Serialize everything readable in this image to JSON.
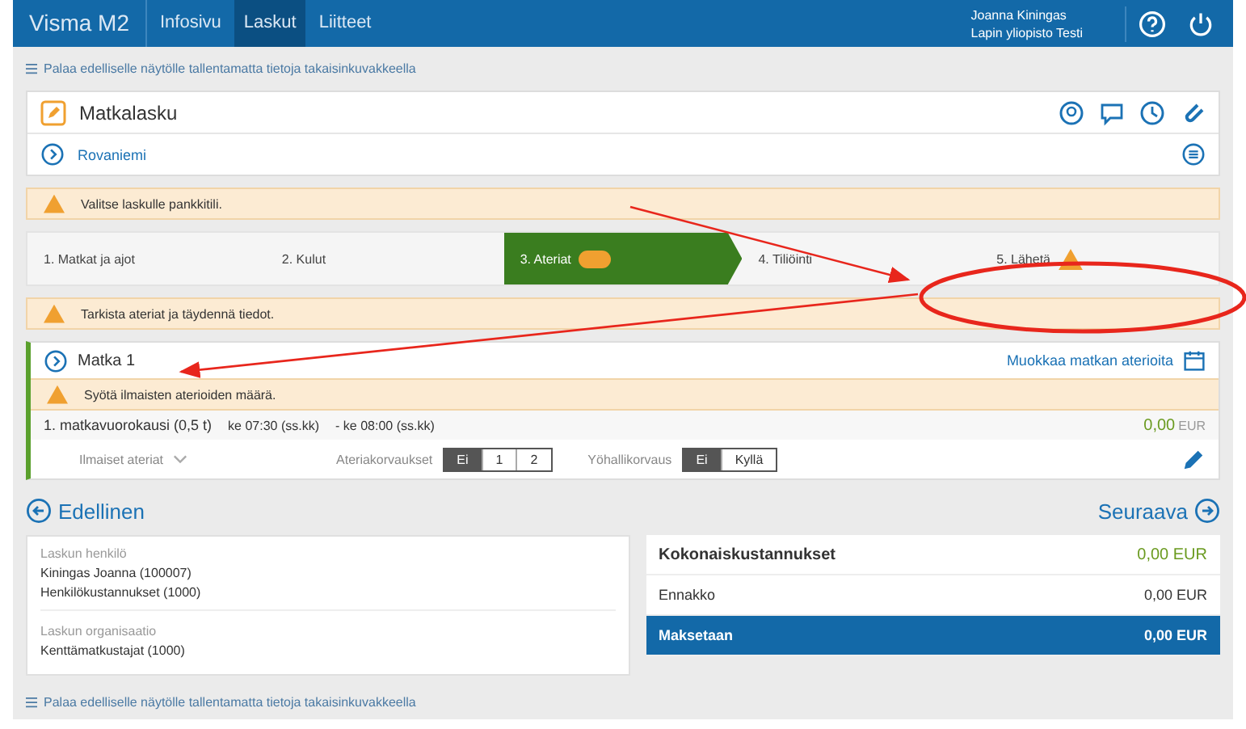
{
  "topbar": {
    "brand": "Visma M2",
    "nav": [
      {
        "label": "Infosivu",
        "selected": false
      },
      {
        "label": "Laskut",
        "selected": true
      },
      {
        "label": "Liitteet",
        "selected": false
      }
    ],
    "user": {
      "name": "Joanna Kiningas",
      "org": "Lapin yliopisto Testi"
    }
  },
  "back_link_top": "Palaa edelliselle näytölle tallentamatta tietoja takaisinkuvakkeella",
  "header": {
    "title": "Matkalasku",
    "subtitle": "Rovaniemi"
  },
  "warning_top": "Valitse laskulle pankkitili.",
  "steps": [
    {
      "label": "1. Matkat ja ajot",
      "selected": false,
      "badge": false,
      "warning": false
    },
    {
      "label": "2. Kulut",
      "selected": false,
      "badge": false,
      "warning": false
    },
    {
      "label": "3. Ateriat",
      "selected": true,
      "badge": true,
      "warning": false
    },
    {
      "label": "4. Tiliöinti",
      "selected": false,
      "badge": false,
      "warning": false
    },
    {
      "label": "5. Lähetä",
      "selected": false,
      "badge": false,
      "warning": true
    }
  ],
  "warning_steps": "Tarkista ateriat ja täydennä tiedot.",
  "trip": {
    "title": "Matka 1",
    "edit_link": "Muokkaa matkan aterioita",
    "warning": "Syötä ilmaisten aterioiden määrä.",
    "day": {
      "label": "1. matkavuorokausi (0,5 t)",
      "start": "ke 07:30 (ss.kk)",
      "end": "- ke 08:00 (ss.kk)",
      "amount": "0,00",
      "currency": "EUR"
    },
    "free_meals_label": "Ilmaiset ateriat",
    "toggles": [
      {
        "label": "Ateriakorvaukset",
        "options": [
          {
            "label": "Ei",
            "selected": true
          },
          {
            "label": "1",
            "selected": false
          },
          {
            "label": "2",
            "selected": false
          }
        ]
      },
      {
        "label": "Yöhallikorvaus",
        "options": [
          {
            "label": "Ei",
            "selected": true
          },
          {
            "label": "Kyllä",
            "selected": false
          }
        ]
      }
    ]
  },
  "nav": {
    "prev": "Edellinen",
    "next": "Seuraava"
  },
  "person": {
    "sections": [
      {
        "heading": "Laskun henkilö",
        "lines": [
          "Kiningas Joanna (100007)",
          "Henkilökustannukset (1000)"
        ]
      },
      {
        "heading": "Laskun organisaatio",
        "lines": [
          "Kenttämatkustajat (1000)"
        ]
      }
    ]
  },
  "summary": [
    {
      "label": "Kokonaiskustannukset",
      "value": "0,00 EUR",
      "kind": "total"
    },
    {
      "label": "Ennakko",
      "value": "0,00 EUR",
      "kind": "plain"
    },
    {
      "label": "Maksetaan",
      "value": "0,00 EUR",
      "kind": "pay"
    }
  ],
  "back_link_bottom": "Palaa edelliselle näytölle tallentamatta tietoja takaisinkuvakkeella"
}
